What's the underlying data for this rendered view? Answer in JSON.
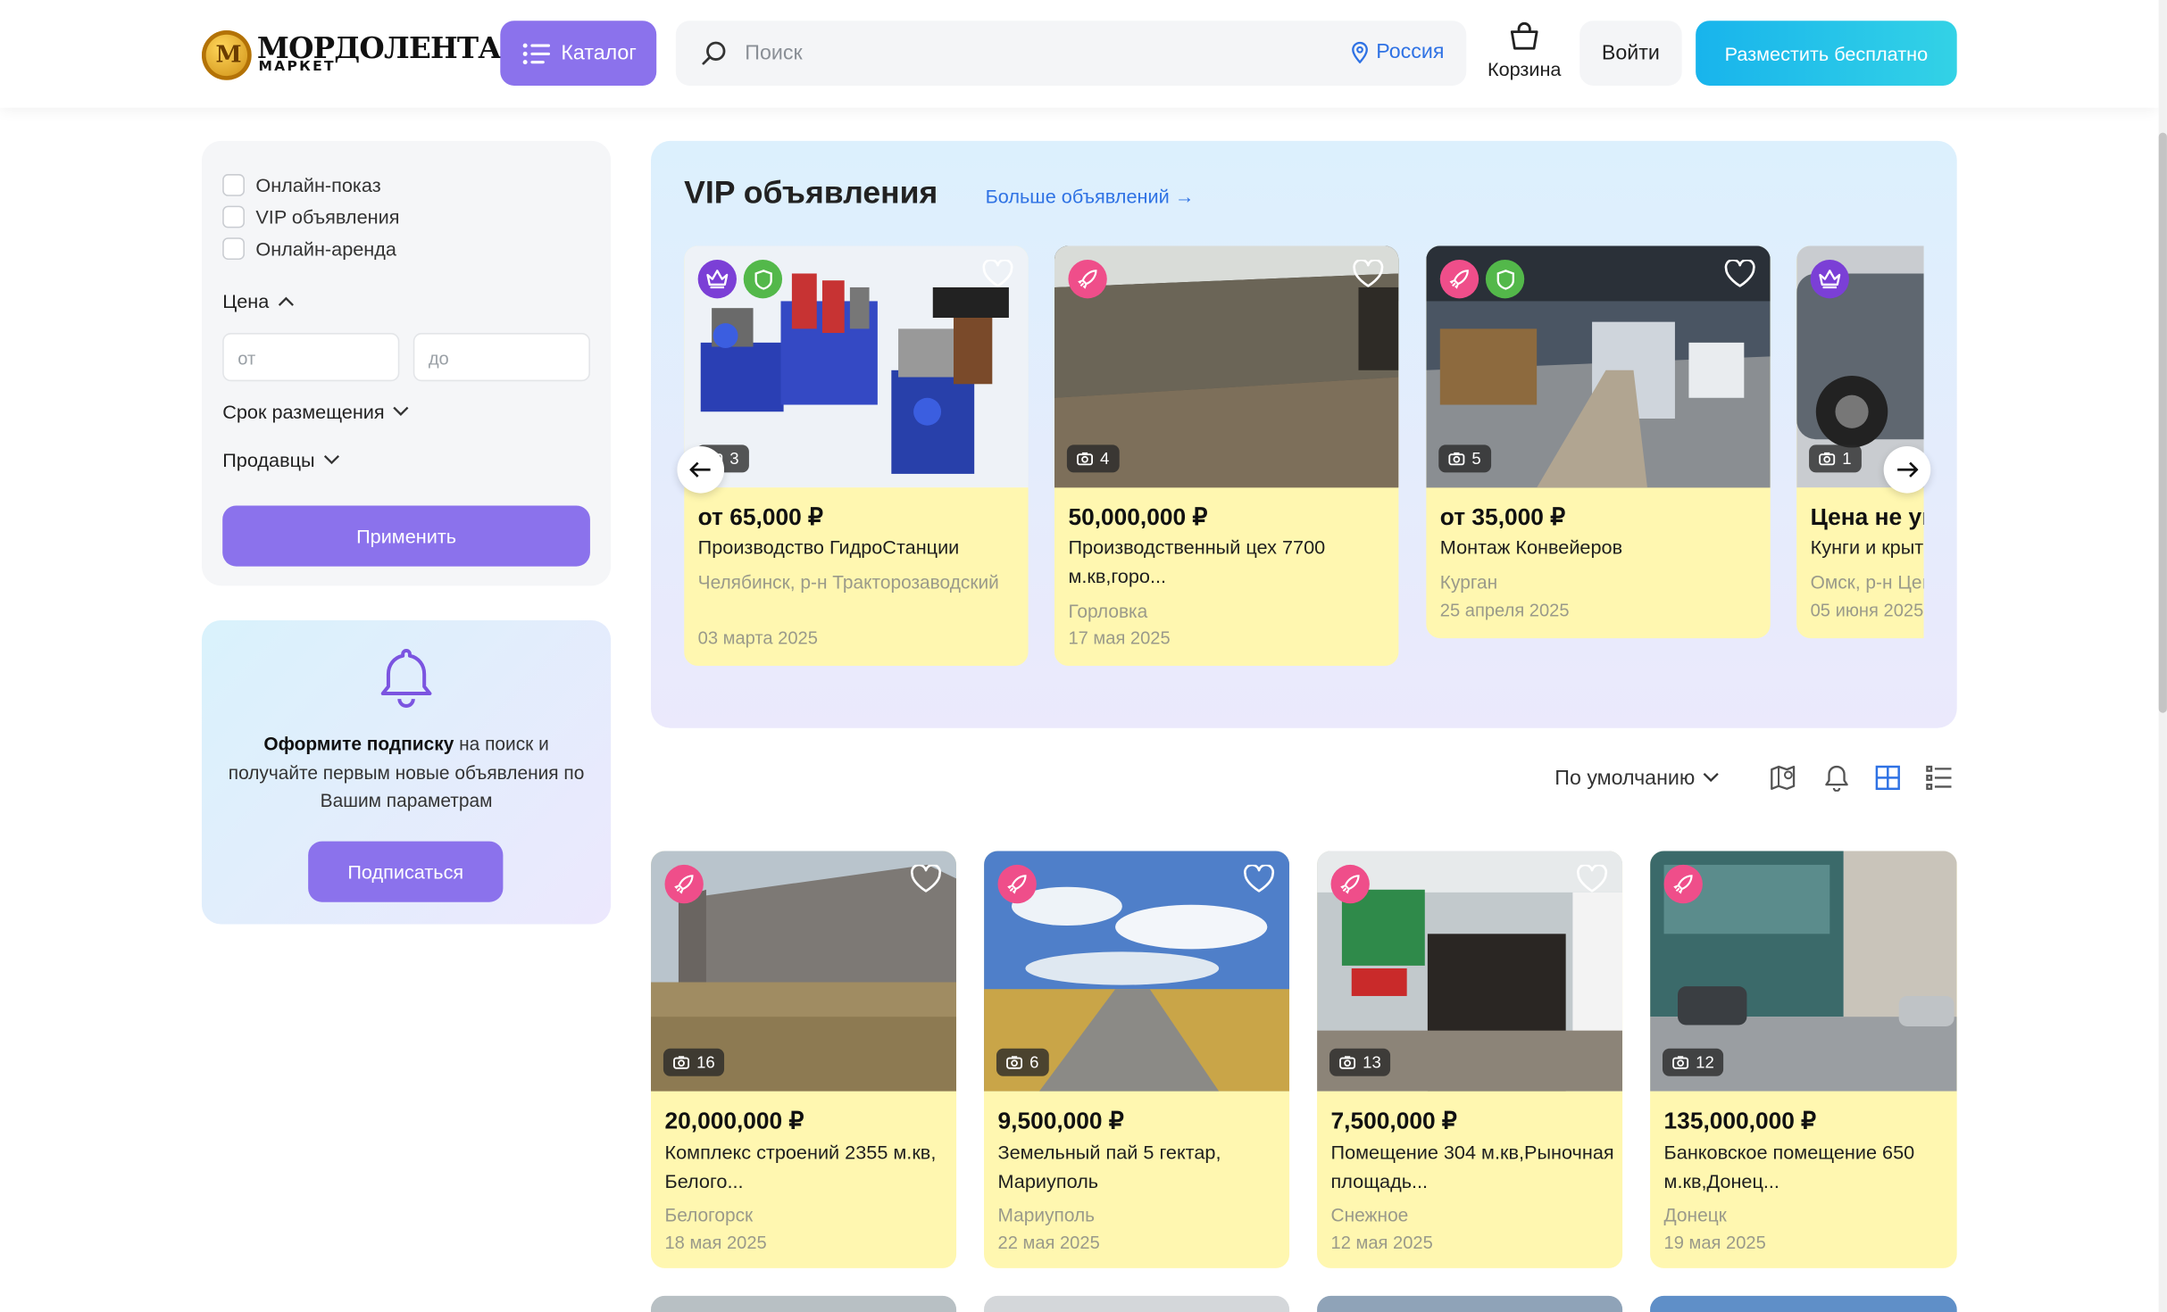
{
  "header": {
    "logo_title": "МОРДОЛЕНТА",
    "logo_subtitle": "МАРКЕТ",
    "catalog_label": "Каталог",
    "search_placeholder": "Поиск",
    "region": "Россия",
    "cart_label": "Корзина",
    "login_label": "Войти",
    "post_label": "Разместить бесплатно"
  },
  "filters": {
    "checkboxes": [
      "Онлайн-показ",
      "VIP объявления",
      "Онлайн-аренда"
    ],
    "price_label": "Цена",
    "price_from": "от",
    "price_to": "до",
    "period_label": "Срок размещения",
    "sellers_label": "Продавцы",
    "apply_label": "Применить"
  },
  "subscribe": {
    "bold": "Оформите подписку",
    "text": " на поиск и получайте первым новые объявления по Вашим параметрам",
    "button": "Подписаться"
  },
  "vip": {
    "title": "VIP объявления",
    "more": "Больше объявлений →",
    "cards": [
      {
        "photos": "3",
        "price": "от 65,000 ₽",
        "title": "Производство ГидроСтанции",
        "location": "Челябинск, р-н Тракторозаводский",
        "date": "03 марта 2025",
        "badges": [
          "crown-icon",
          "shield-icon"
        ]
      },
      {
        "photos": "4",
        "price": "50,000,000 ₽",
        "title": "Производственный цех 7700 м.кв,горо...",
        "location": "Горловка",
        "date": "17 мая 2025",
        "badges": [
          "rocket-icon"
        ]
      },
      {
        "photos": "5",
        "price": "от 35,000 ₽",
        "title": "Монтаж Конвейеров",
        "location": "Курган",
        "date": "25 апреля 2025",
        "badges": [
          "rocket-icon",
          "shield-icon"
        ]
      },
      {
        "photos": "1",
        "price": "Цена не указана",
        "title": "Кунги и крытые",
        "location": "Омск, р-н Центральный",
        "date": "05 июня 2025",
        "badges": [
          "crown-icon"
        ]
      }
    ]
  },
  "toolbar": {
    "sort_label": "По умолчанию"
  },
  "listings": [
    {
      "photos": "16",
      "price": "20,000,000 ₽",
      "title": "Комплекс строений 2355 м.кв, Белого...",
      "location": "Белогорск",
      "date": "18 мая 2025"
    },
    {
      "photos": "6",
      "price": "9,500,000 ₽",
      "title": "Земельный пай 5 гектар, Мариуполь",
      "location": "Мариуполь",
      "date": "22 мая 2025"
    },
    {
      "photos": "13",
      "price": "7,500,000 ₽",
      "title": "Помещение 304 м.кв,Рыночная площадь...",
      "location": "Снежное",
      "date": "12 мая 2025"
    },
    {
      "photos": "12",
      "price": "135,000,000 ₽",
      "title": "Банковское помещение 650 м.кв,Донец...",
      "location": "Донецк",
      "date": "19 мая 2025"
    }
  ],
  "colors": {
    "accent": "#8b72ec",
    "link": "#2f72e4",
    "card_bg": "#fff7b0",
    "badge_rocket": "#ef4e8a",
    "badge_crown": "#7b3fd6",
    "badge_shield": "#53b84a"
  }
}
